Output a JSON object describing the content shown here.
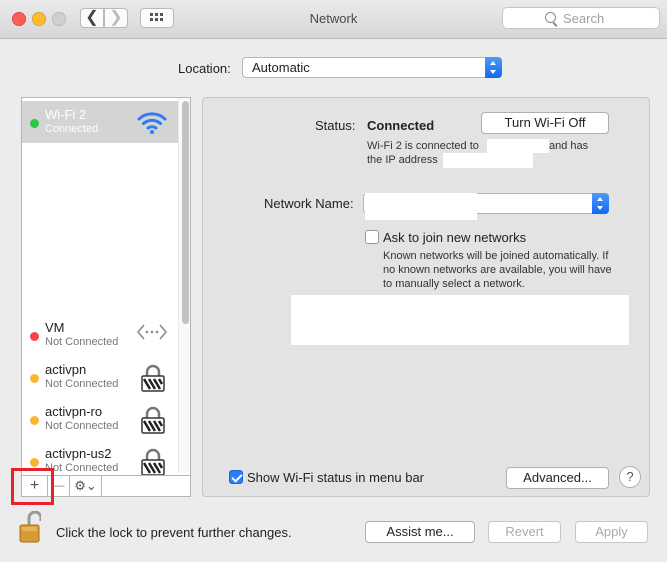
{
  "window": {
    "title": "Network"
  },
  "toolbar": {
    "back": "❮",
    "forward": "❯",
    "search_placeholder": "Search"
  },
  "location": {
    "label": "Location:",
    "value": "Automatic"
  },
  "services": [
    {
      "name": "Wi-Fi 2",
      "status": "Connected",
      "dot": "#2ec549",
      "icon": "wifi-icon",
      "selected": true
    },
    {
      "name": "VM",
      "status": "Not Connected",
      "dot": "#f5454a",
      "icon": "ethernet-arrows-icon"
    },
    {
      "name": "activpn",
      "status": "Not Connected",
      "dot": "#f7b731",
      "icon": "vpn-lock-icon"
    },
    {
      "name": "activpn-ro",
      "status": "Not Connected",
      "dot": "#f7b731",
      "icon": "vpn-lock-icon"
    },
    {
      "name": "activpn-us2",
      "status": "Not Connected",
      "dot": "#f7b731",
      "icon": "vpn-lock-icon"
    }
  ],
  "sidebar_tools": {
    "add": "+",
    "remove": "—",
    "action": "⚙⌄"
  },
  "detail": {
    "status_label": "Status:",
    "status_value": "Connected",
    "turn_off_button": "Turn Wi-Fi Off",
    "status_line1_prefix": "Wi-Fi 2 is connected to",
    "status_line1_suffix": "and has",
    "status_line2": "the IP address",
    "network_name_label": "Network Name:",
    "ask_join_label": "Ask to join new networks",
    "ask_join_checked": false,
    "help_text": [
      "Known networks will be joined automatically. If",
      "no known networks are available, you will have",
      "to manually select a network."
    ],
    "show_status_label": "Show Wi-Fi status in menu bar",
    "show_status_checked": true,
    "advanced_button": "Advanced...",
    "help_button": "?"
  },
  "footer": {
    "lock_text": "Click the lock to prevent further changes.",
    "assist_button": "Assist me...",
    "revert_button": "Revert",
    "apply_button": "Apply"
  },
  "colors": {
    "accent": "#2e7cf6",
    "highlight_box": "#e8222a"
  }
}
